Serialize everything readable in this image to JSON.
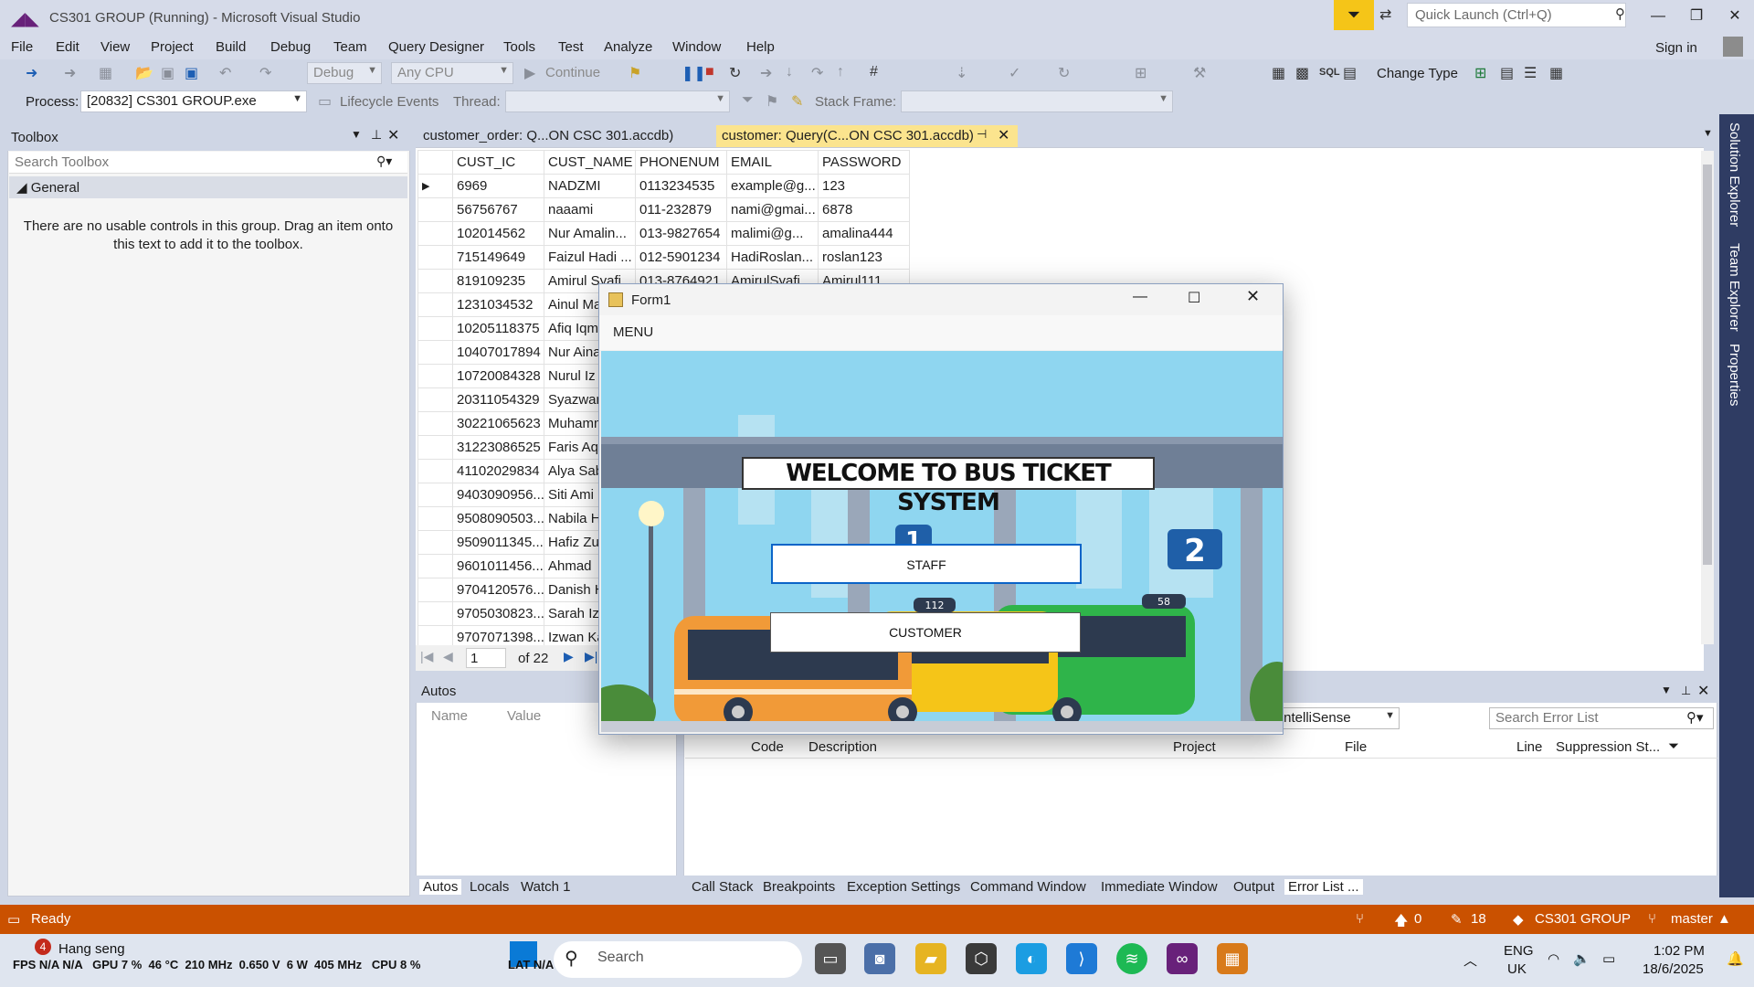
{
  "titlebar": {
    "title": "CS301 GROUP (Running) - Microsoft Visual Studio",
    "quick_launch_placeholder": "Quick Launch (Ctrl+Q)"
  },
  "menu": [
    "File",
    "Edit",
    "View",
    "Project",
    "Build",
    "Debug",
    "Team",
    "Query Designer",
    "Tools",
    "Test",
    "Analyze",
    "Window",
    "Help"
  ],
  "signin": "Sign in",
  "toolbar1": {
    "config": "Debug",
    "platform": "Any CPU",
    "continue": "Continue",
    "change_type": "Change Type",
    "sql": "SQL"
  },
  "toolbar2": {
    "process_label": "Process:",
    "process_value": "[20832] CS301 GROUP.exe",
    "lifecycle": "Lifecycle Events",
    "thread_label": "Thread:",
    "stack_label": "Stack Frame:"
  },
  "toolbox": {
    "title": "Toolbox",
    "search_placeholder": "Search Toolbox",
    "group": "General",
    "empty_text": "There are no usable controls in this group. Drag an item onto this text to add it to the toolbox."
  },
  "tabs": {
    "tab1": "customer_order: Q...ON  CSC 301.accdb)",
    "tab2": "customer: Query(C...ON  CSC 301.accdb)"
  },
  "grid": {
    "columns": [
      "CUST_IC",
      "CUST_NAME",
      "PHONENUM",
      "EMAIL",
      "PASSWORD"
    ],
    "rows": [
      [
        "6969",
        "NADZMI",
        "0113234535",
        "example@g...",
        "123"
      ],
      [
        "56756767",
        "naaami",
        "011-232879",
        "nami@gmai...",
        "6878"
      ],
      [
        "102014562",
        "Nur Amalin...",
        "013-9827654",
        "malimi@g...",
        "amalina444"
      ],
      [
        "715149649",
        "Faizul Hadi ...",
        "012-5901234",
        "HadiRoslan...",
        "roslan123"
      ],
      [
        "819109235",
        "Amirul Syafi...",
        "013-8764921",
        "AmirulSyafi...",
        "Amirul111"
      ],
      [
        "1231034532",
        "Ainul Ma",
        "",
        "",
        ""
      ],
      [
        "10205118375",
        "Afiq Iqm",
        "",
        "",
        ""
      ],
      [
        "10407017894",
        "Nur Aina",
        "",
        "",
        ""
      ],
      [
        "10720084328",
        "Nurul Iz",
        "",
        "",
        ""
      ],
      [
        "20311054329",
        "Syazwan",
        "",
        "",
        ""
      ],
      [
        "30221065623",
        "Muhamm",
        "",
        "",
        ""
      ],
      [
        "31223086525",
        "Faris Aq",
        "",
        "",
        ""
      ],
      [
        "41102029834",
        "Alya Sab",
        "",
        "",
        ""
      ],
      [
        "9403090956...",
        "Siti Ami",
        "",
        "",
        ""
      ],
      [
        "9508090503...",
        "Nabila H",
        "",
        "",
        ""
      ],
      [
        "9509011345...",
        "Hafiz Zu",
        "",
        "",
        ""
      ],
      [
        "9601011456...",
        "Ahmad",
        "",
        "",
        ""
      ],
      [
        "9704120576...",
        "Danish H",
        "",
        "",
        ""
      ],
      [
        "9705030823...",
        "Sarah Iz",
        "",
        "",
        ""
      ],
      [
        "9707071398...",
        "Izwan Ka",
        "",
        "",
        ""
      ]
    ],
    "nav_page": "1",
    "nav_of": "of 22"
  },
  "autos": {
    "title": "Autos",
    "col_name": "Name",
    "col_value": "Value",
    "tabs": [
      "Autos",
      "Locals",
      "Watch 1"
    ]
  },
  "error_list": {
    "filter": "IntelliSense",
    "search_placeholder": "Search Error List",
    "columns": [
      "Code",
      "Description",
      "Project",
      "File",
      "Line",
      "Suppression St..."
    ],
    "tabs": [
      "Call Stack",
      "Breakpoints",
      "Exception Settings",
      "Command Window",
      "Immediate Window",
      "Output",
      "Error List ..."
    ]
  },
  "right_dock": [
    "Solution Explorer",
    "Team Explorer",
    "Properties"
  ],
  "status": {
    "ready": "Ready",
    "up_count": "0",
    "edit_count": "18",
    "project": "CS301 GROUP",
    "branch": "master"
  },
  "taskbar": {
    "notif_count": "4",
    "hang_seng": "Hang seng",
    "perf": "FPS N/A N/A   GPU 7 %  46 °C  210 MHz  0.650 V  6 W  405 MHz   CPU 8 %",
    "lat": "LAT N/A N/A",
    "search": "Search",
    "lang1": "ENG",
    "lang2": "UK",
    "time": "1:02 PM",
    "date": "18/6/2025"
  },
  "form1": {
    "title": "Form1",
    "menu": "MENU",
    "welcome": "WELCOME TO BUS TICKET SYSTEM",
    "staff": "STAFF",
    "customer": "CUSTOMER",
    "stop1": "1",
    "stop2": "2",
    "bus1": "112",
    "bus2": "58"
  }
}
